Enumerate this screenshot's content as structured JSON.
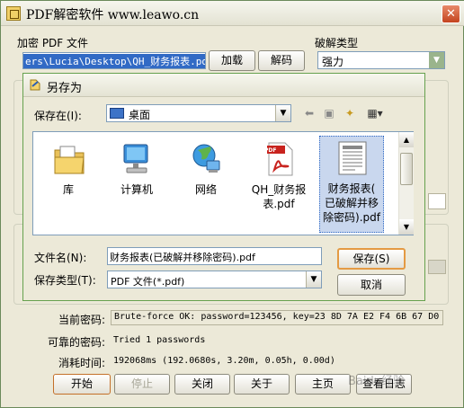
{
  "main": {
    "title": "PDF解密软件 www.leawo.cn",
    "close_glyph": "✕",
    "pdf_group_label": "加密 PDF 文件",
    "path_value": "ers\\Lucia\\Desktop\\QH_财务报表.pdf",
    "load_button": "加载",
    "decrypt_button": "解码",
    "crack_type_label": "破解类型",
    "crack_type_value": "强力",
    "current_password_label": "当前密码:",
    "current_password_value": "Brute-force OK: password=123456, key=23 8D 7A E2 F4 6B 67 D0",
    "possible_password_label": "可靠的密码:",
    "possible_password_value": "Tried 1 passwords",
    "time_label": "消耗时间:",
    "time_value": "192068ms (192.0680s, 3.20m, 0.05h, 0.00d)",
    "buttons": {
      "start": "开始",
      "stop": "停止",
      "close": "关闭",
      "about": "关于",
      "home": "主页",
      "log": "查看日志"
    }
  },
  "dialog": {
    "title": "另存为",
    "save_in_label": "保存在(I):",
    "save_in_value": "桌面",
    "files": [
      {
        "name": "库",
        "icon": "library-folder-icon"
      },
      {
        "name": "计算机",
        "icon": "computer-icon"
      },
      {
        "name": "网络",
        "icon": "network-globe-icon"
      },
      {
        "name": "QH_财务报表.pdf",
        "icon": "pdf-file-icon"
      },
      {
        "name": "财务报表(已破解并移除密码).pdf",
        "icon": "document-thumbnail-icon"
      }
    ],
    "file_captions": [
      [
        "库"
      ],
      [
        "计算机"
      ],
      [
        "网络"
      ],
      [
        "QH_财务报",
        "表.pdf"
      ],
      [
        "财务报表(",
        "已破解并移",
        "除密码).pdf"
      ]
    ],
    "filename_label": "文件名(N):",
    "filename_value": "财务报表(已破解并移除密码).pdf",
    "filetype_label": "保存类型(T):",
    "filetype_value": "PDF 文件(*.pdf)",
    "save_button": "保存(S)",
    "cancel_button": "取消"
  },
  "watermark": "Baidu经验",
  "colors": {
    "selection": "#316ac5",
    "window_bg": "#ece9d8",
    "focus": "#e49a43"
  }
}
